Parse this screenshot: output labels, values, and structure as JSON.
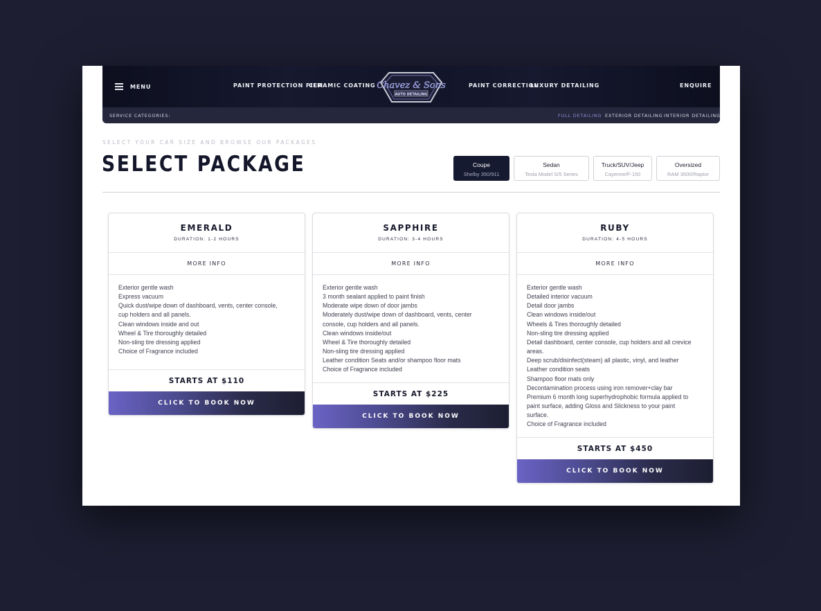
{
  "nav": {
    "menu_label": "MENU",
    "links_left": [
      "PAINT PROTECTION FILM",
      "CERAMIC COATING"
    ],
    "links_right": [
      "PAINT CORRECTION",
      "LUXURY DETAILING"
    ],
    "enquire_label": "ENQUIRE",
    "logo": {
      "script_text": "Chavez & Sons",
      "tagline": "AUTO DETAILING"
    }
  },
  "subnav": {
    "label": "SERVICE CATEGORIES:",
    "categories": [
      {
        "label": "FULL DETAILING",
        "active": true
      },
      {
        "label": "EXTERIOR DETAILING",
        "active": false
      },
      {
        "label": "INTERIOR DETAILING",
        "active": false
      }
    ]
  },
  "header": {
    "eyebrow": "SELECT YOUR CAR SIZE AND BROWSE OUR PACKAGES",
    "title": "SELECT PACKAGE"
  },
  "sizes": [
    {
      "name": "Coupe",
      "example": "Shelby 350/911",
      "active": true
    },
    {
      "name": "Sedan",
      "example": "Tesla Model S/5 Series",
      "active": false
    },
    {
      "name": "Truck/SUV/Jeep",
      "example": "Cayenne/F-150",
      "active": false
    },
    {
      "name": "Oversized",
      "example": "RAM 3500/Raptor",
      "active": false
    }
  ],
  "packages": [
    {
      "name": "EMERALD",
      "duration": "DURATION: 1-2 HOURS",
      "more_info": "MORE INFO",
      "features": [
        "Exterior gentle wash",
        "Express vacuum",
        "Quick dust/wipe down of dashboard, vents, center console,",
        "cup holders and all panels.",
        "Clean windows inside and out",
        "Wheel & Tire thoroughly detailed",
        "Non-sling tire dressing applied",
        "Choice of Fragrance included"
      ],
      "price": "STARTS AT $110",
      "cta": "CLICK TO BOOK NOW"
    },
    {
      "name": "SAPPHIRE",
      "duration": "DURATION: 3-4 HOURS",
      "more_info": "MORE INFO",
      "features": [
        "Exterior gentle wash",
        "3 month sealant applied to paint finish",
        "Moderate wipe down of door jambs",
        "Moderately dust/wipe down of dashboard, vents, center",
        "console, cup holders and all panels.",
        "Clean windows inside/out",
        "Wheel & Tire thoroughly detailed",
        "Non-sling tire dressing applied",
        "Leather condition Seats and/or shampoo floor mats",
        "Choice of Fragrance included"
      ],
      "price": "STARTS AT $225",
      "cta": "CLICK TO BOOK NOW"
    },
    {
      "name": "RUBY",
      "duration": "DURATION: 4-5 HOURS",
      "more_info": "MORE INFO",
      "features": [
        "Exterior gentle wash",
        "Detailed interior vacuum",
        "Detail door jambs",
        "Clean windows inside/out",
        "Wheels & Tires thoroughly detailed",
        "Non-sling tire dressing applied",
        "Detail dashboard, center console, cup holders and all crevice",
        "areas.",
        "Deep scrub/disinfect(steam) all plastic, vinyl, and leather",
        "Leather condition seats",
        "Shampoo floor mats only",
        "Decontamination process using iron remover+clay bar",
        "Premium 6 month long superhydrophobic formula applied to",
        "paint surface, adding Gloss and Slickness to your paint",
        "surface.",
        "Choice of Fragrance included"
      ],
      "price": "STARTS AT $450",
      "cta": "CLICK TO BOOK NOW"
    }
  ],
  "colors": {
    "background": "#1d1e31",
    "nav_dark": "#0f1122",
    "subbar": "#25273c",
    "accent": "#6a63c4",
    "active_category": "#8d90d8"
  }
}
